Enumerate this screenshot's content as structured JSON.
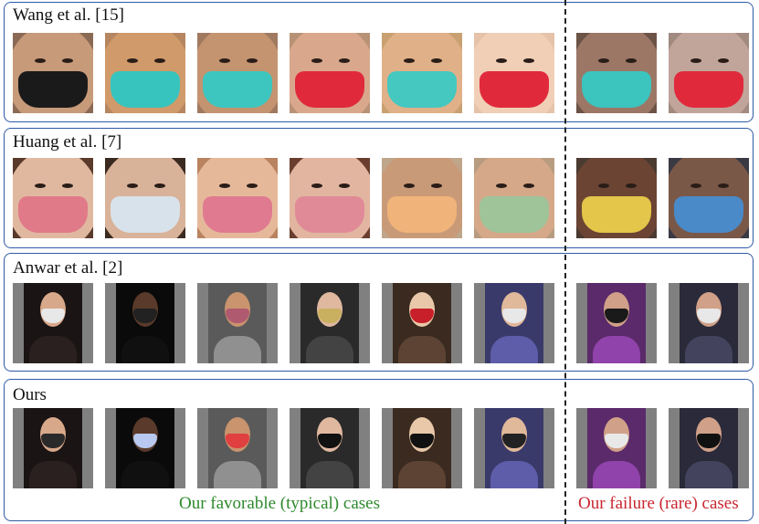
{
  "panels": [
    {
      "label": "Wang et al. [15]",
      "kind": "crop",
      "images": [
        {
          "skin": "#c79a7a",
          "bg": "#8a6a55",
          "mask": "#1a1a1a"
        },
        {
          "skin": "#d09a6a",
          "bg": "#b68660",
          "mask": "#38c4be"
        },
        {
          "skin": "#c49470",
          "bg": "#a07a60",
          "mask": "#3cc6bf"
        },
        {
          "skin": "#d9a88c",
          "bg": "#b89276",
          "mask": "#e02a3c"
        },
        {
          "skin": "#e0b089",
          "bg": "#c9a070",
          "mask": "#44c8c0"
        },
        {
          "skin": "#f0cfb6",
          "bg": "#e6c2a8",
          "mask": "#e02a3c"
        },
        {
          "skin": "#9c7766",
          "bg": "#6b5346",
          "mask": "#3cc4bf"
        },
        {
          "skin": "#c2a59a",
          "bg": "#a18a80",
          "mask": "#e02a3c"
        }
      ]
    },
    {
      "label": "Huang et al. [7]",
      "kind": "crop",
      "images": [
        {
          "skin": "#e0b8a0",
          "bg": "#5a3a2a",
          "mask": "#e07a88"
        },
        {
          "skin": "#d9b29a",
          "bg": "#3a2a20",
          "mask": "#d8e2ea"
        },
        {
          "skin": "#e6b89a",
          "bg": "#b8835e",
          "mask": "#e07a90"
        },
        {
          "skin": "#e2b5a0",
          "bg": "#6a3e2e",
          "mask": "#e08a98"
        },
        {
          "skin": "#c99a78",
          "bg": "#bfa58a",
          "mask": "#f0b47a"
        },
        {
          "skin": "#d4a888",
          "bg": "#b89c80",
          "mask": "#9fc49a"
        },
        {
          "skin": "#6b4434",
          "bg": "#4a3a30",
          "mask": "#e3c64a"
        },
        {
          "skin": "#7a5848",
          "bg": "#3a3a44",
          "mask": "#4a8ac8"
        }
      ]
    },
    {
      "label": "Anwar et al. [2]",
      "kind": "full",
      "images": [
        {
          "skin": "#d8a88a",
          "bg": "#1a1414",
          "mask": "#e8e8e8"
        },
        {
          "skin": "#5a3a2a",
          "bg": "#0a0a0a",
          "mask": "#222222"
        },
        {
          "skin": "#c9946e",
          "bg": "#5a5a5a",
          "mask": "#b05a70"
        },
        {
          "skin": "#e0b8a0",
          "bg": "#2a2a2a",
          "mask": "#c8b060"
        },
        {
          "skin": "#e8c8a8",
          "bg": "#3a2a20",
          "mask": "#c8202a"
        },
        {
          "skin": "#e0b89a",
          "bg": "#3a3a6a",
          "mask": "#e8e8e8"
        },
        {
          "skin": "#d0a088",
          "bg": "#5a2a6a",
          "mask": "#1a1a1a"
        },
        {
          "skin": "#d0a088",
          "bg": "#2a2a3a",
          "mask": "#e8e8e8"
        }
      ]
    },
    {
      "label": "Ours",
      "kind": "full",
      "images": [
        {
          "skin": "#d8a88a",
          "bg": "#1a1414",
          "mask": "#2a2a2a"
        },
        {
          "skin": "#5a3a2a",
          "bg": "#0a0a0a",
          "mask": "#b8c8ee"
        },
        {
          "skin": "#c9946e",
          "bg": "#5a5a5a",
          "mask": "#e04040"
        },
        {
          "skin": "#e0b8a0",
          "bg": "#2a2a2a",
          "mask": "#111111"
        },
        {
          "skin": "#e8c8a8",
          "bg": "#3a2a20",
          "mask": "#111111"
        },
        {
          "skin": "#e0b89a",
          "bg": "#3a3a6a",
          "mask": "#222222"
        },
        {
          "skin": "#d0a088",
          "bg": "#5a2a6a",
          "mask": "#e8e8e8"
        },
        {
          "skin": "#d0a088",
          "bg": "#2a2a3a",
          "mask": "#111111"
        }
      ]
    }
  ],
  "captions": {
    "favorable": "Our favorable (typical) cases",
    "failure": "Our failure (rare) cases"
  },
  "colors": {
    "border": "#2f5aa6",
    "favorable": "#2d8a2d",
    "failure": "#c8262f"
  }
}
